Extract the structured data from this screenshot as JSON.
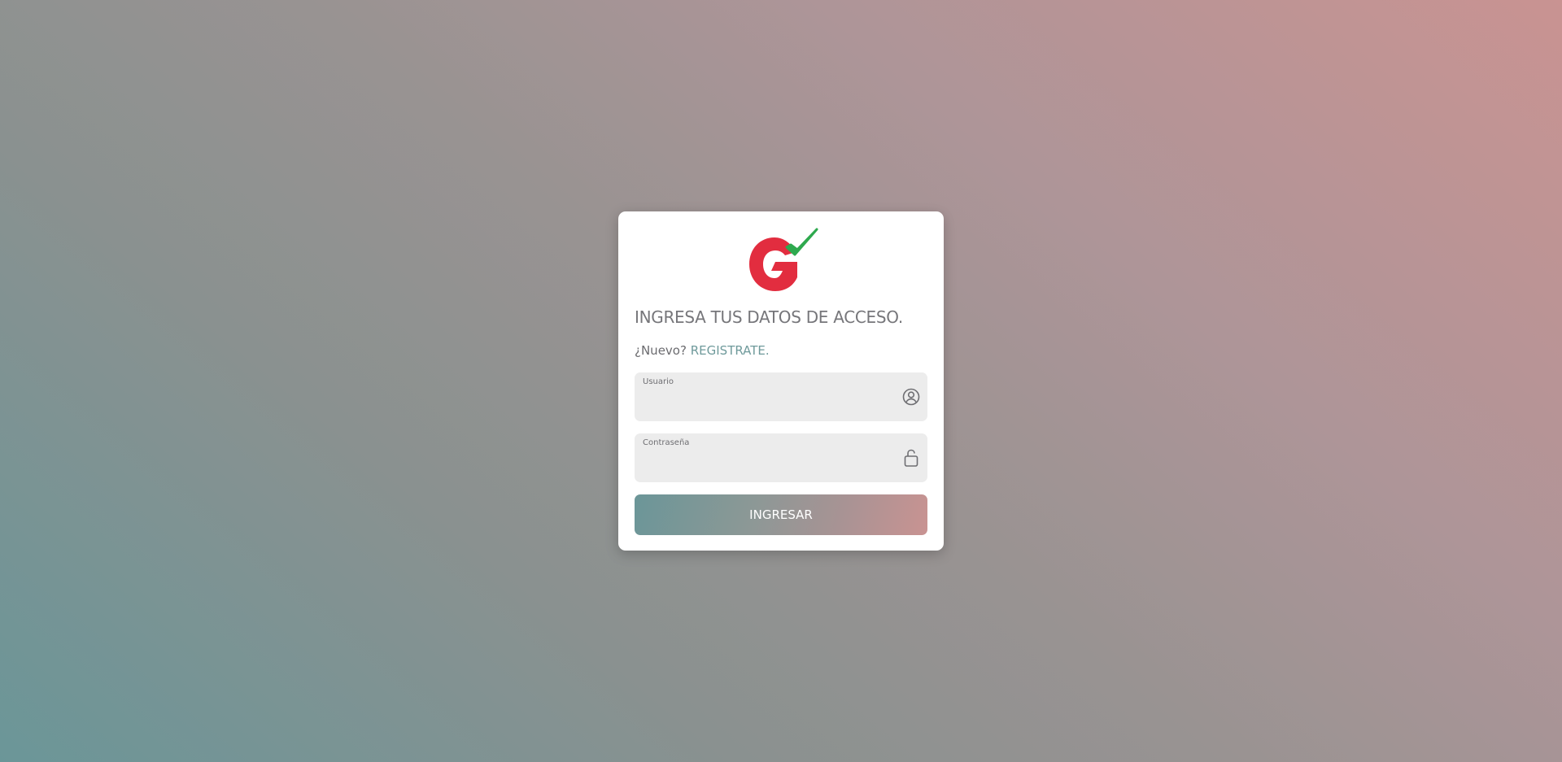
{
  "login": {
    "heading": "INGRESA TUS DATOS DE ACCESO.",
    "new_prompt": "¿Nuevo?",
    "register_link": "REGISTRATE.",
    "username_label": "Usuario",
    "username_value": "",
    "password_label": "Contraseña",
    "password_value": "",
    "submit_label": "INGRESAR"
  },
  "icons": {
    "username": "user-circle-icon",
    "password": "lock-icon"
  },
  "colors": {
    "logo_red": "#e22d3f",
    "logo_green": "#2ea94e",
    "link": "#6f9a9b",
    "gradient_start": "#6b9698",
    "gradient_end": "#c99392"
  }
}
